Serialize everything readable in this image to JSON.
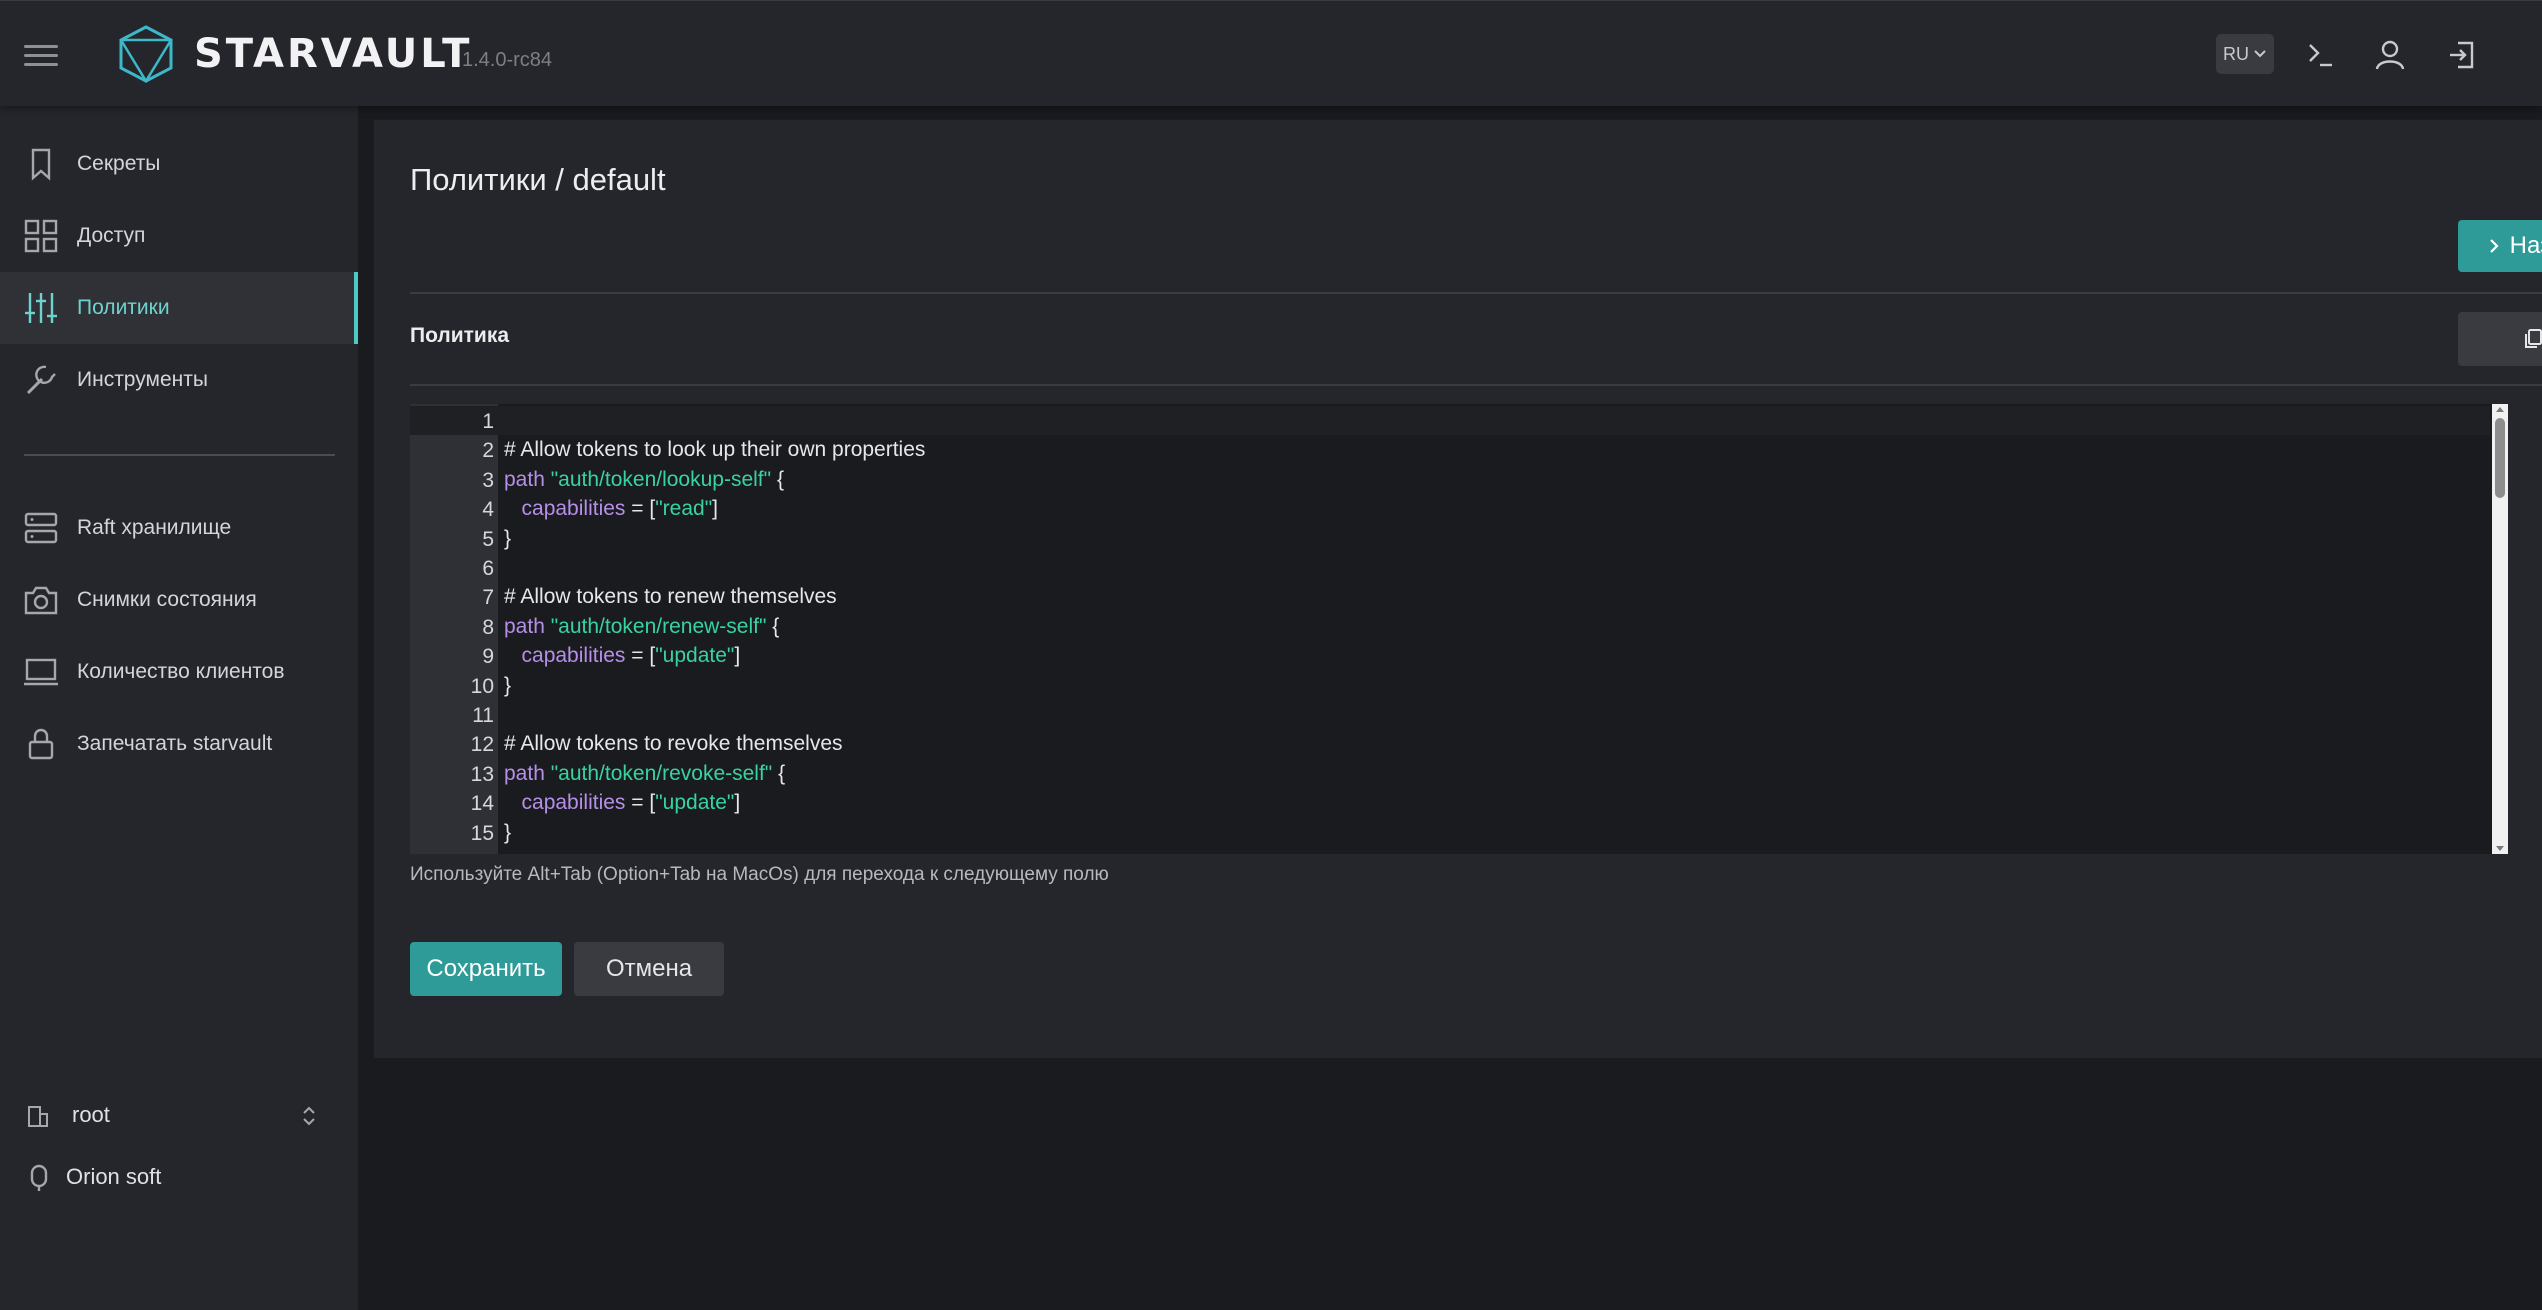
{
  "header": {
    "logo_text": "STARVAULT",
    "version": "1.4.0-rc84",
    "lang": "RU"
  },
  "sidebar": {
    "items": [
      {
        "label": "Секреты",
        "icon": "bookmark-icon"
      },
      {
        "label": "Доступ",
        "icon": "grid-icon"
      },
      {
        "label": "Политики",
        "icon": "sliders-icon",
        "active": true
      },
      {
        "label": "Инструменты",
        "icon": "wrench-icon"
      },
      {
        "label": "Raft хранилище",
        "icon": "server-icon"
      },
      {
        "label": "Снимки состояния",
        "icon": "camera-icon"
      },
      {
        "label": "Количество клиентов",
        "icon": "laptop-icon"
      },
      {
        "label": "Запечатать starvault",
        "icon": "lock-icon"
      }
    ],
    "namespace": "root",
    "org": "Orion soft"
  },
  "main": {
    "title": "Политики / default",
    "back_label": "Назад",
    "policy_label": "Политика",
    "hint": "Используйте Alt+Tab (Option+Tab на MacOs) для перехода к следующему полю",
    "save_label": "Сохранить",
    "cancel_label": "Отмена"
  },
  "editor": {
    "lines": [
      {
        "n": "1",
        "parts": []
      },
      {
        "n": "2",
        "parts": [
          {
            "t": "# Allow tokens to look up their own properties",
            "c": "comment"
          }
        ]
      },
      {
        "n": "3",
        "parts": [
          {
            "t": "path",
            "c": "kw"
          },
          {
            "t": " ",
            "c": ""
          },
          {
            "t": "\"auth/token/lookup-self\"",
            "c": "str"
          },
          {
            "t": " {",
            "c": ""
          }
        ]
      },
      {
        "n": "4",
        "parts": [
          {
            "t": "   ",
            "c": ""
          },
          {
            "t": "capabilities",
            "c": "kw"
          },
          {
            "t": " = [",
            "c": ""
          },
          {
            "t": "\"read\"",
            "c": "str"
          },
          {
            "t": "]",
            "c": ""
          }
        ]
      },
      {
        "n": "5",
        "parts": [
          {
            "t": "}",
            "c": ""
          }
        ]
      },
      {
        "n": "6",
        "parts": []
      },
      {
        "n": "7",
        "parts": [
          {
            "t": "# Allow tokens to renew themselves",
            "c": "comment"
          }
        ]
      },
      {
        "n": "8",
        "parts": [
          {
            "t": "path",
            "c": "kw"
          },
          {
            "t": " ",
            "c": ""
          },
          {
            "t": "\"auth/token/renew-self\"",
            "c": "str"
          },
          {
            "t": " {",
            "c": ""
          }
        ]
      },
      {
        "n": "9",
        "parts": [
          {
            "t": "   ",
            "c": ""
          },
          {
            "t": "capabilities",
            "c": "kw"
          },
          {
            "t": " = [",
            "c": ""
          },
          {
            "t": "\"update\"",
            "c": "str"
          },
          {
            "t": "]",
            "c": ""
          }
        ]
      },
      {
        "n": "10",
        "parts": [
          {
            "t": "}",
            "c": ""
          }
        ]
      },
      {
        "n": "11",
        "parts": []
      },
      {
        "n": "12",
        "parts": [
          {
            "t": "# Allow tokens to revoke themselves",
            "c": "comment"
          }
        ]
      },
      {
        "n": "13",
        "parts": [
          {
            "t": "path",
            "c": "kw"
          },
          {
            "t": " ",
            "c": ""
          },
          {
            "t": "\"auth/token/revoke-self\"",
            "c": "str"
          },
          {
            "t": " {",
            "c": ""
          }
        ]
      },
      {
        "n": "14",
        "parts": [
          {
            "t": "   ",
            "c": ""
          },
          {
            "t": "capabilities",
            "c": "kw"
          },
          {
            "t": " = [",
            "c": ""
          },
          {
            "t": "\"update\"",
            "c": "str"
          },
          {
            "t": "]",
            "c": ""
          }
        ]
      },
      {
        "n": "15",
        "parts": [
          {
            "t": "}",
            "c": ""
          }
        ]
      }
    ]
  },
  "colors": {
    "accent": "#4ec9c3",
    "button_primary": "#2f9b98",
    "keyword": "#b58fe8",
    "string": "#38d39f"
  }
}
